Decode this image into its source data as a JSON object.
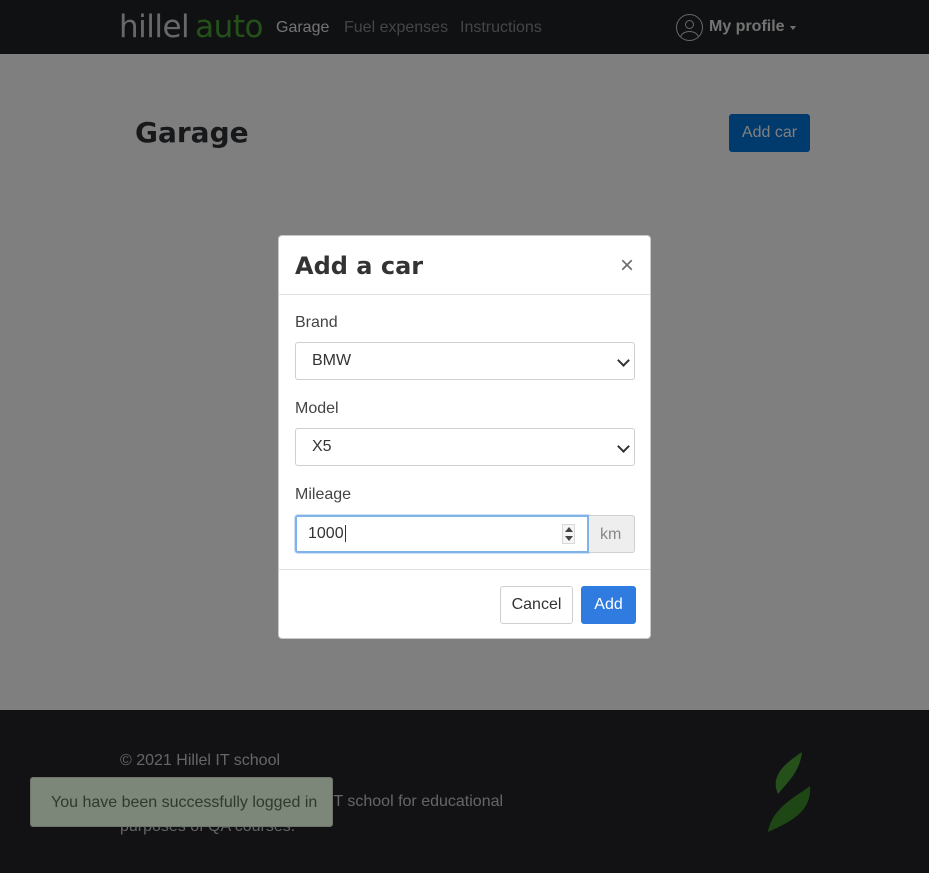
{
  "header": {
    "logo": {
      "part1": "hillel",
      "part2": "auto"
    },
    "nav": [
      {
        "label": "Garage"
      },
      {
        "label": "Fuel expenses"
      },
      {
        "label": "Instructions"
      }
    ],
    "profile_label": "My profile"
  },
  "main": {
    "title": "Garage",
    "add_car_label": "Add car"
  },
  "modal": {
    "title": "Add a car",
    "close_glyph": "×",
    "brand": {
      "label": "Brand",
      "value": "BMW"
    },
    "model": {
      "label": "Model",
      "value": "X5"
    },
    "mileage": {
      "label": "Mileage",
      "value": "1000",
      "unit": "km"
    },
    "cancel_label": "Cancel",
    "add_label": "Add"
  },
  "footer": {
    "copyright": "© 2021 Hillel IT school",
    "description": "Hillel auto developed in Hillel IT school for educational purposes of QA courses."
  },
  "toast": {
    "message": "You have been successfully logged in"
  },
  "colors": {
    "header_bg": "#212226",
    "brand_green": "#4aa134",
    "primary_blue": "#0275d8",
    "footer_bg": "#242529"
  }
}
